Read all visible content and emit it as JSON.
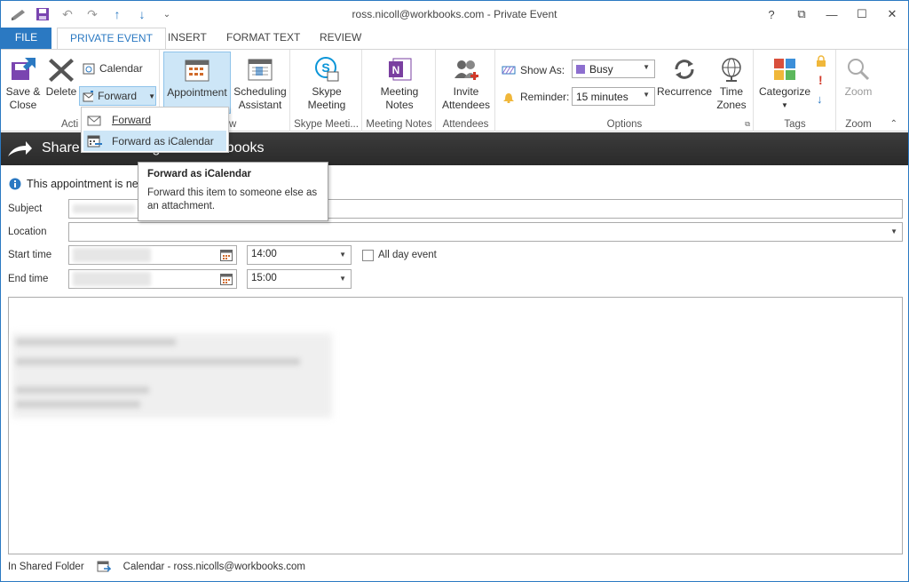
{
  "window": {
    "title": "ross.nicoll@workbooks.com - Private Event",
    "controls": [
      "?",
      "⧉",
      "—",
      "☐",
      "✕"
    ]
  },
  "tabs": [
    "FILE",
    "PRIVATE EVENT",
    "INSERT",
    "FORMAT TEXT",
    "REVIEW"
  ],
  "ribbon": {
    "actions": {
      "save_close": "Save &\nClose",
      "delete": "Delete",
      "calendar": "Calendar",
      "forward": "Forward",
      "label": "Acti"
    },
    "show": {
      "appointment": "Appointment",
      "scheduling": "Scheduling\nAssistant",
      "label": "w"
    },
    "skype": {
      "meeting": "Skype\nMeeting",
      "label": "Skype Meeti..."
    },
    "meeting_notes": {
      "btn": "Meeting\nNotes",
      "label": "Meeting Notes"
    },
    "attendees": {
      "invite": "Invite\nAttendees",
      "label": "Attendees"
    },
    "options": {
      "show_as_label": "Show As:",
      "show_as_value": "Busy",
      "reminder_label": "Reminder:",
      "reminder_value": "15 minutes",
      "recurrence": "Recurrence",
      "time_zones": "Time\nZones",
      "label": "Options"
    },
    "tags": {
      "categorize": "Categorize",
      "label": "Tags"
    },
    "zoom": {
      "btn": "Zoom",
      "label": "Zoom"
    }
  },
  "banner": {
    "text": "Share this meeting with Workbooks"
  },
  "info": {
    "text": "This appointment is nex"
  },
  "form": {
    "subject_label": "Subject",
    "location_label": "Location",
    "start_label": "Start time",
    "start_time": "14:00",
    "all_day": "All day event",
    "end_label": "End time",
    "end_time": "15:00"
  },
  "forward_menu": {
    "items": [
      "Forward",
      "Forward as iCalendar"
    ]
  },
  "tooltip": {
    "title": "Forward as iCalendar",
    "body": "Forward this item to someone else as an attachment."
  },
  "status": {
    "folder_label": "In Shared Folder",
    "folder_value": "Calendar - ross.nicolls@workbooks.com"
  },
  "colors": {
    "accent": "#2b79c2",
    "busy": "#8d6fcf",
    "selected": "#cde6f7"
  }
}
